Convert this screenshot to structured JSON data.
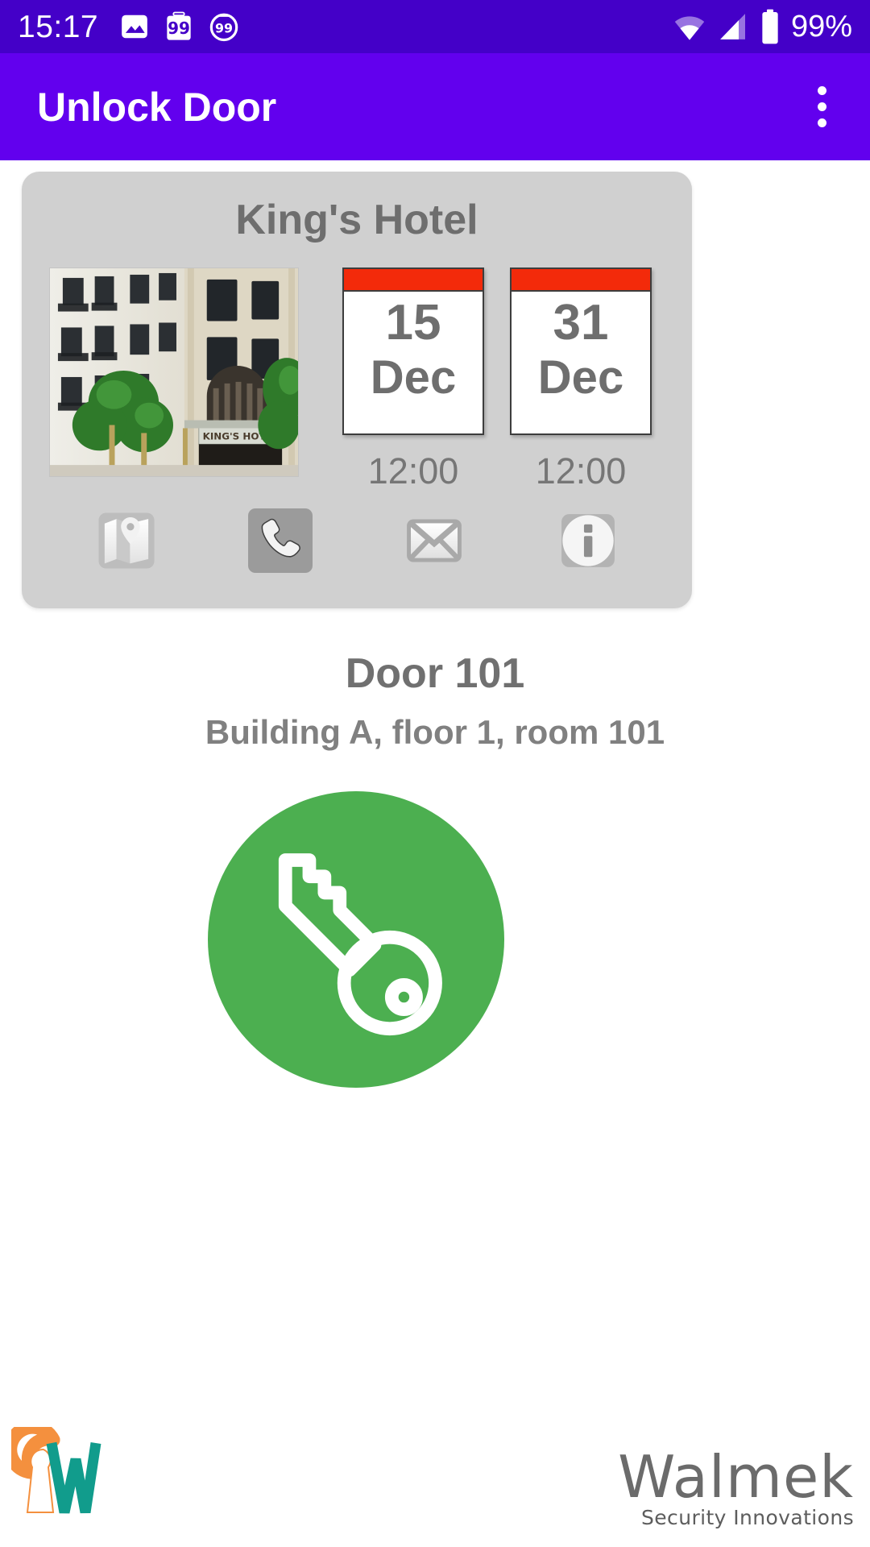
{
  "status_bar": {
    "clock": "15:17",
    "battery_percent": "99%",
    "left_icons": [
      {
        "name": "image-icon",
        "label": "image"
      },
      {
        "name": "badge-99-square-icon",
        "label": "99"
      },
      {
        "name": "badge-99-circle-icon",
        "label": "99"
      }
    ],
    "right_icons": [
      {
        "name": "wifi-icon",
        "label": "wifi"
      },
      {
        "name": "cellular-signal-icon",
        "label": "signal"
      },
      {
        "name": "battery-icon",
        "label": "battery"
      }
    ],
    "background_color": "#4400c8"
  },
  "app_bar": {
    "title": "Unlock Door",
    "overflow_label": "More options",
    "background_color": "#6200ee"
  },
  "hotel_card": {
    "name": "King's Hotel",
    "photo_alt": "KING'S HOTEL",
    "photo_sign_text": "KING'S HOTEL",
    "checkin": {
      "day": "15",
      "month": "Dec",
      "time": "12:00"
    },
    "checkout": {
      "day": "31",
      "month": "Dec",
      "time": "12:00"
    },
    "calendar_header_color": "#f32a0a",
    "card_background": "#d0d0d0",
    "actions": [
      {
        "name": "map-icon",
        "label": "Map"
      },
      {
        "name": "phone-icon",
        "label": "Call"
      },
      {
        "name": "email-icon",
        "label": "Email"
      },
      {
        "name": "info-icon",
        "label": "Info"
      }
    ]
  },
  "door": {
    "title": "Door 101",
    "subtitle": "Building A, floor 1, room 101"
  },
  "unlock_button": {
    "label": "Unlock",
    "icon": "key-icon",
    "color": "#4CAF50"
  },
  "footer": {
    "logo_name": "walmek-keyhole-w-logo",
    "brand_name": "Walmek",
    "brand_tagline": "Security Innovations",
    "logo_orange": "#F4903E",
    "logo_teal": "#119C8C"
  }
}
